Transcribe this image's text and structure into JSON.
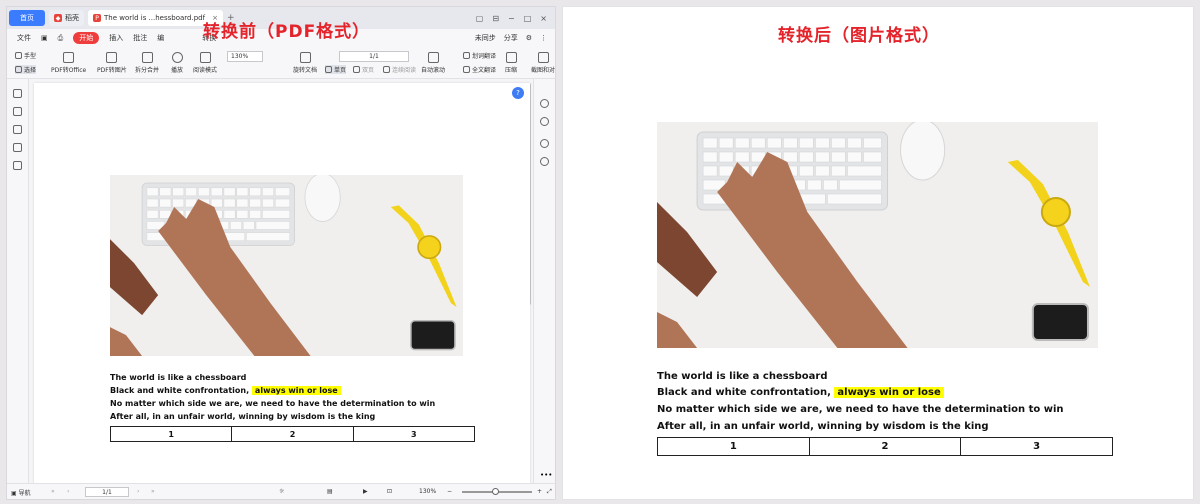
{
  "left": {
    "overlay_title": "转换前（PDF格式）",
    "tabs": {
      "home": "首页",
      "app": "稻壳",
      "doc": "The world is ...hessboard.pdf",
      "close": "×",
      "add": "+"
    },
    "window_controls": [
      "▢",
      "⊟",
      "−",
      "□",
      "×"
    ],
    "menu": {
      "file": "文件",
      "start": "开始",
      "insert": "插入",
      "annotate": "批注",
      "edit": "编",
      "convert": "转换",
      "sync": "未同步",
      "share": "分享"
    },
    "toolbar": {
      "hand": "手型",
      "select": "选择",
      "pdf_to_office": "PDF转Office",
      "pdf_to_image": "PDF转图片",
      "split_merge": "拆分合并",
      "play": "播放",
      "read_mode": "阅读模式",
      "zoom": "130%",
      "rotate": "旋转文档",
      "page": "1/1",
      "single_page": "单页",
      "double_page": "双页",
      "continuous": "连续阅读",
      "auto_scroll": "自动滚动",
      "word_translate": "划词翻译",
      "full_translate": "全文翻译",
      "compress": "压缩",
      "screenshot_compare": "截图和对"
    },
    "status": {
      "nav": "导航",
      "page": "1/1",
      "zoom": "130%"
    }
  },
  "right": {
    "overlay_title": "转换后（图片格式）"
  },
  "document": {
    "lines": [
      "The world is like a chessboard",
      "Black and white confrontation,",
      "No matter which side we are, we need to have the determination to win",
      "After all, in an unfair world, winning by wisdom is the king"
    ],
    "highlight": "always win or lose",
    "table_cells": [
      "1",
      "2",
      "3"
    ]
  },
  "colors": {
    "overlay_red": "#e4232b",
    "highlight": "#ffff00",
    "start_tab": "#ef3d3d",
    "home_tab": "#3b7cff"
  }
}
